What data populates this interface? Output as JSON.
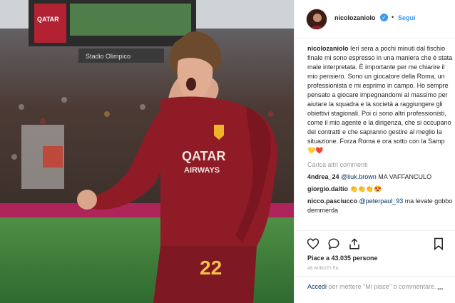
{
  "post": {
    "username": "nicolozaniolo",
    "follow_label": "Segui",
    "separator": "•",
    "verified_mark": "✓",
    "caption_text": "Ieri sera a pochi minuti dal fischio finale mi sono espresso in una maniera che è stata male interpretata. È importante per me chiarire il mio pensiero. Sono un giocatore della Roma, un professionista e mi esprimo in campo. Ho sempre pensato a giocare impegnandomi al massimo per aiutare la squadra e la società a raggiungere gli obiettivi stagionali. Poi ci sono altri professionisti, come il mio agente e la dirigenza, che si occupano dei contratti e che sapranno gestire al meglio la situazione. Forza Roma e ora sotto con la Samp",
    "caption_emoji": "💛❤️",
    "more_comments_label": "Carica altri commenti",
    "comments": [
      {
        "user": "4ndrea_24",
        "mention": "@liuk.brown",
        "text": "MA VAFFANCULO"
      },
      {
        "user": "giorgio.daltio",
        "mention": "",
        "text": "👏👏👏😍"
      },
      {
        "user": "nicco.pasciucco",
        "mention": "@peterpaul_93",
        "text": "ma levate gobbo demmerda"
      }
    ],
    "likes": "Piace a 43.035 persone",
    "time_ago": "48 MINUTI FA",
    "login_link": "Accedi",
    "login_text": "per mettere \"Mi piace\" o commentare.",
    "more_options": "..."
  },
  "photo": {
    "jersey_sponsor_line1": "QATAR",
    "jersey_sponsor_line2": "AIRWAYS",
    "jersey_number": "22",
    "stadium_sign": "Stadio Olimpico",
    "board_text_1": "QATAR",
    "board_text_2": "AIRWAYS",
    "colors": {
      "jersey": "#8e1b25",
      "pitch": "#3c7a3a",
      "ad_board": "#b0245c"
    }
  }
}
